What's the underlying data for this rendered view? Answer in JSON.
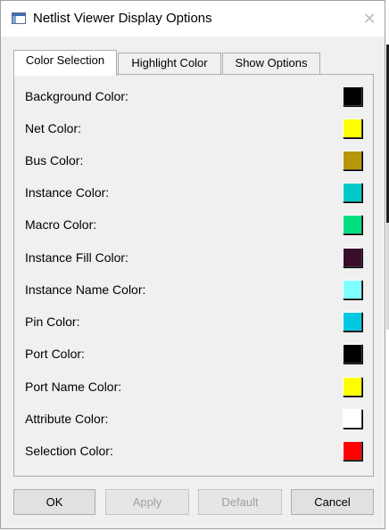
{
  "window": {
    "title": "Netlist Viewer Display Options"
  },
  "tabs": [
    {
      "label": "Color Selection",
      "active": true
    },
    {
      "label": "Highlight Color",
      "active": false
    },
    {
      "label": "Show Options",
      "active": false
    }
  ],
  "colors": [
    {
      "label": "Background Color:",
      "color": "#000000"
    },
    {
      "label": "Net Color:",
      "color": "#ffff00"
    },
    {
      "label": "Bus Color:",
      "color": "#b8960a"
    },
    {
      "label": "Instance Color:",
      "color": "#00c8c8"
    },
    {
      "label": "Macro Color:",
      "color": "#00e080"
    },
    {
      "label": "Instance Fill Color:",
      "color": "#3a0d2a"
    },
    {
      "label": "Instance Name Color:",
      "color": "#80ffff"
    },
    {
      "label": "Pin Color:",
      "color": "#00c8e0"
    },
    {
      "label": "Port Color:",
      "color": "#000000"
    },
    {
      "label": "Port Name Color:",
      "color": "#ffff00"
    },
    {
      "label": "Attribute Color:",
      "color": "#ffffff"
    },
    {
      "label": "Selection Color:",
      "color": "#ff0000"
    }
  ],
  "buttons": {
    "ok": "OK",
    "apply": "Apply",
    "default": "Default",
    "cancel": "Cancel"
  }
}
